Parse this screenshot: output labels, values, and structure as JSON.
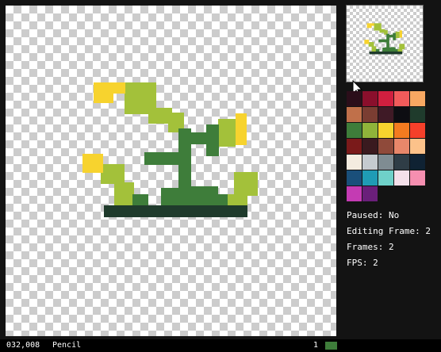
{
  "info": {
    "paused": "Paused: No",
    "editing_frame": "Editing Frame: 2",
    "frames": "Frames: 2",
    "fps": "FPS: 2"
  },
  "status": {
    "coordinates": "032,008",
    "tool": "Pencil",
    "frame": "1",
    "current_color": "#3e7d3a"
  },
  "palette": [
    "#2b0e1a",
    "#8a0f2c",
    "#d01f3f",
    "#f15b5b",
    "#f7a862",
    "#c0704a",
    "#7a3d32",
    "#3f1a26",
    "#0d0d12",
    "#1f3b2c",
    "#3e7d3a",
    "#8fb43a",
    "#f7d32e",
    "#f47b20",
    "#f5402a",
    "#7a1a1a",
    "#3a1a1f",
    "#8f4a3a",
    "#e8876a",
    "#fcc28a",
    "#f4ece0",
    "#c5cbd0",
    "#7f8c92",
    "#2f3d46",
    "#0f2233",
    "#1a4f7a",
    "#1f9cb5",
    "#6fd1c9",
    "#f4e0ea",
    "#f58fb0",
    "#c43bb3",
    "#6a1f7a"
  ],
  "sprite_colors": {
    "leaf": "#a3c13a",
    "stem": "#3e7d3a",
    "flower": "#f7d32e",
    "soil": "#1f3b2c"
  }
}
